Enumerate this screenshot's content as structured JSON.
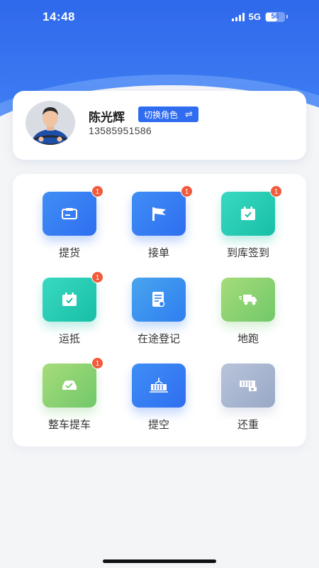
{
  "status_bar": {
    "time": "14:48",
    "network": "5G",
    "battery": "56"
  },
  "profile": {
    "name": "陈光辉",
    "switch_role_label": "切换角色",
    "switch_icon": "⇌",
    "phone": "13585951586"
  },
  "menu": [
    {
      "label": "提货",
      "icon": "cargo-box-icon",
      "color": "blue",
      "badge": "1"
    },
    {
      "label": "接单",
      "icon": "flag-icon",
      "color": "blue",
      "badge": "1"
    },
    {
      "label": "到库签到",
      "icon": "calendar-check-icon",
      "color": "teal",
      "badge": "1"
    },
    {
      "label": "运抵",
      "icon": "calendar-check-icon",
      "color": "teal",
      "badge": "1"
    },
    {
      "label": "在途登记",
      "icon": "document-icon",
      "color": "sky",
      "badge": ""
    },
    {
      "label": "地跑",
      "icon": "delivery-truck-icon",
      "color": "green",
      "badge": ""
    },
    {
      "label": "整车提车",
      "icon": "car-icon",
      "color": "green",
      "badge": "1"
    },
    {
      "label": "提空",
      "icon": "crane-container-icon",
      "color": "blue",
      "badge": ""
    },
    {
      "label": "还重",
      "icon": "container-return-icon",
      "color": "gray",
      "badge": ""
    }
  ]
}
